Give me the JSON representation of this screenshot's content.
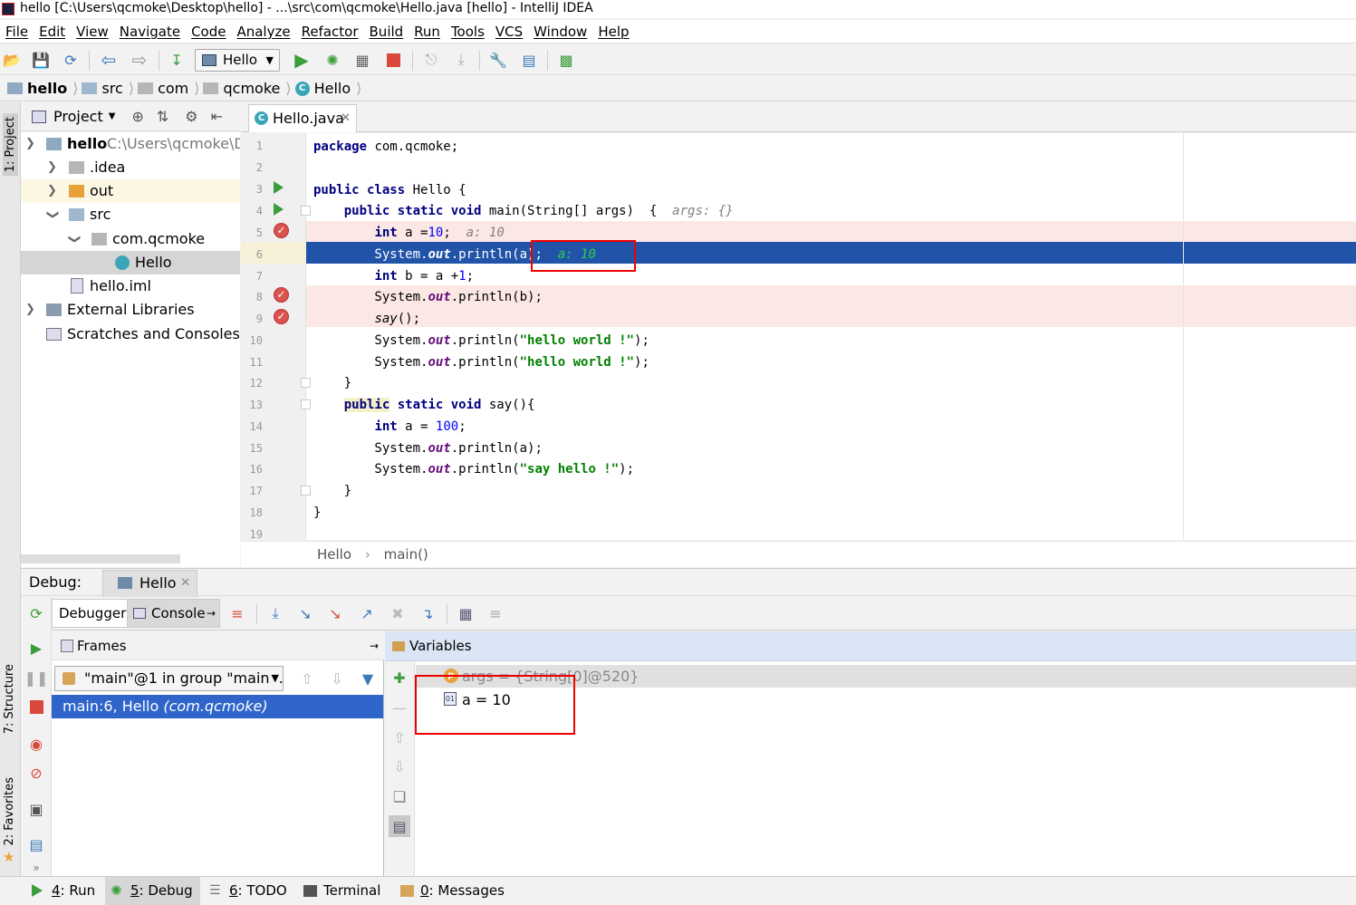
{
  "window": {
    "title": "hello [C:\\Users\\qcmoke\\Desktop\\hello] - ...\\src\\com\\qcmoke\\Hello.java [hello] - IntelliJ IDEA"
  },
  "menu": [
    "File",
    "Edit",
    "View",
    "Navigate",
    "Code",
    "Analyze",
    "Refactor",
    "Build",
    "Run",
    "Tools",
    "VCS",
    "Window",
    "Help"
  ],
  "toolbar": {
    "run_config": "Hello"
  },
  "breadcrumb": [
    "hello",
    "src",
    "com",
    "qcmoke",
    "Hello"
  ],
  "left_stripe": {
    "project": "1: Project",
    "structure": "7: Structure",
    "favorites": "2: Favorites"
  },
  "project": {
    "header": "Project",
    "tree": {
      "root_name": "hello",
      "root_path": "C:\\Users\\qcmoke\\De",
      "idea": ".idea",
      "out": "out",
      "src": "src",
      "pkg": "com.qcmoke",
      "hello_class": "Hello",
      "iml": "hello.iml",
      "ext_libs": "External Libraries",
      "scratches": "Scratches and Consoles"
    }
  },
  "editor": {
    "tab": "Hello.java",
    "line_numbers": [
      "1",
      "2",
      "3",
      "4",
      "5",
      "6",
      "7",
      "8",
      "9",
      "10",
      "11",
      "12",
      "13",
      "14",
      "15",
      "16",
      "17",
      "18",
      "19"
    ],
    "hint_args": "args: {}",
    "hint_a1": "a: 10",
    "hint_a2": "a: 10",
    "breadcrumb_class": "Hello",
    "breadcrumb_method": "main()"
  },
  "debug": {
    "label": "Debug:",
    "tab": "Hello",
    "debugger_tab": "Debugger",
    "console_tab": "Console",
    "frames_header": "Frames",
    "thread": "\"main\"@1 in group \"main...",
    "frame": "main:6, Hello",
    "frame_pkg": "(com.qcmoke)",
    "variables_header": "Variables",
    "var_args": "args = {String[0]@520}",
    "var_a": "a = 10"
  },
  "statusbar": {
    "run_num": "4",
    "run": ": Run",
    "debug_num": "5",
    "debug": ": Debug",
    "todo_num": "6",
    "todo": ": TODO",
    "terminal": "Terminal",
    "messages_num": "0",
    "messages": ": Messages"
  },
  "colors": {
    "selection": "#2154a8",
    "breakpoint": "#d9534f",
    "annotation_box": "#ee0000"
  }
}
